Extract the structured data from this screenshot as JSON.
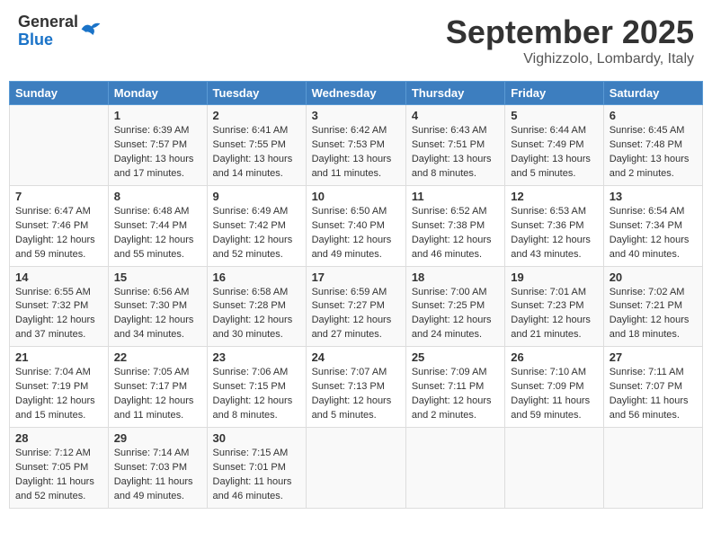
{
  "header": {
    "logo": {
      "general": "General",
      "blue": "Blue"
    },
    "title": "September 2025",
    "location": "Vighizzolo, Lombardy, Italy"
  },
  "calendar": {
    "days_of_week": [
      "Sunday",
      "Monday",
      "Tuesday",
      "Wednesday",
      "Thursday",
      "Friday",
      "Saturday"
    ],
    "weeks": [
      [
        {
          "day": "",
          "sunrise": "",
          "sunset": "",
          "daylight": ""
        },
        {
          "day": "1",
          "sunrise": "Sunrise: 6:39 AM",
          "sunset": "Sunset: 7:57 PM",
          "daylight": "Daylight: 13 hours and 17 minutes."
        },
        {
          "day": "2",
          "sunrise": "Sunrise: 6:41 AM",
          "sunset": "Sunset: 7:55 PM",
          "daylight": "Daylight: 13 hours and 14 minutes."
        },
        {
          "day": "3",
          "sunrise": "Sunrise: 6:42 AM",
          "sunset": "Sunset: 7:53 PM",
          "daylight": "Daylight: 13 hours and 11 minutes."
        },
        {
          "day": "4",
          "sunrise": "Sunrise: 6:43 AM",
          "sunset": "Sunset: 7:51 PM",
          "daylight": "Daylight: 13 hours and 8 minutes."
        },
        {
          "day": "5",
          "sunrise": "Sunrise: 6:44 AM",
          "sunset": "Sunset: 7:49 PM",
          "daylight": "Daylight: 13 hours and 5 minutes."
        },
        {
          "day": "6",
          "sunrise": "Sunrise: 6:45 AM",
          "sunset": "Sunset: 7:48 PM",
          "daylight": "Daylight: 13 hours and 2 minutes."
        }
      ],
      [
        {
          "day": "7",
          "sunrise": "Sunrise: 6:47 AM",
          "sunset": "Sunset: 7:46 PM",
          "daylight": "Daylight: 12 hours and 59 minutes."
        },
        {
          "day": "8",
          "sunrise": "Sunrise: 6:48 AM",
          "sunset": "Sunset: 7:44 PM",
          "daylight": "Daylight: 12 hours and 55 minutes."
        },
        {
          "day": "9",
          "sunrise": "Sunrise: 6:49 AM",
          "sunset": "Sunset: 7:42 PM",
          "daylight": "Daylight: 12 hours and 52 minutes."
        },
        {
          "day": "10",
          "sunrise": "Sunrise: 6:50 AM",
          "sunset": "Sunset: 7:40 PM",
          "daylight": "Daylight: 12 hours and 49 minutes."
        },
        {
          "day": "11",
          "sunrise": "Sunrise: 6:52 AM",
          "sunset": "Sunset: 7:38 PM",
          "daylight": "Daylight: 12 hours and 46 minutes."
        },
        {
          "day": "12",
          "sunrise": "Sunrise: 6:53 AM",
          "sunset": "Sunset: 7:36 PM",
          "daylight": "Daylight: 12 hours and 43 minutes."
        },
        {
          "day": "13",
          "sunrise": "Sunrise: 6:54 AM",
          "sunset": "Sunset: 7:34 PM",
          "daylight": "Daylight: 12 hours and 40 minutes."
        }
      ],
      [
        {
          "day": "14",
          "sunrise": "Sunrise: 6:55 AM",
          "sunset": "Sunset: 7:32 PM",
          "daylight": "Daylight: 12 hours and 37 minutes."
        },
        {
          "day": "15",
          "sunrise": "Sunrise: 6:56 AM",
          "sunset": "Sunset: 7:30 PM",
          "daylight": "Daylight: 12 hours and 34 minutes."
        },
        {
          "day": "16",
          "sunrise": "Sunrise: 6:58 AM",
          "sunset": "Sunset: 7:28 PM",
          "daylight": "Daylight: 12 hours and 30 minutes."
        },
        {
          "day": "17",
          "sunrise": "Sunrise: 6:59 AM",
          "sunset": "Sunset: 7:27 PM",
          "daylight": "Daylight: 12 hours and 27 minutes."
        },
        {
          "day": "18",
          "sunrise": "Sunrise: 7:00 AM",
          "sunset": "Sunset: 7:25 PM",
          "daylight": "Daylight: 12 hours and 24 minutes."
        },
        {
          "day": "19",
          "sunrise": "Sunrise: 7:01 AM",
          "sunset": "Sunset: 7:23 PM",
          "daylight": "Daylight: 12 hours and 21 minutes."
        },
        {
          "day": "20",
          "sunrise": "Sunrise: 7:02 AM",
          "sunset": "Sunset: 7:21 PM",
          "daylight": "Daylight: 12 hours and 18 minutes."
        }
      ],
      [
        {
          "day": "21",
          "sunrise": "Sunrise: 7:04 AM",
          "sunset": "Sunset: 7:19 PM",
          "daylight": "Daylight: 12 hours and 15 minutes."
        },
        {
          "day": "22",
          "sunrise": "Sunrise: 7:05 AM",
          "sunset": "Sunset: 7:17 PM",
          "daylight": "Daylight: 12 hours and 11 minutes."
        },
        {
          "day": "23",
          "sunrise": "Sunrise: 7:06 AM",
          "sunset": "Sunset: 7:15 PM",
          "daylight": "Daylight: 12 hours and 8 minutes."
        },
        {
          "day": "24",
          "sunrise": "Sunrise: 7:07 AM",
          "sunset": "Sunset: 7:13 PM",
          "daylight": "Daylight: 12 hours and 5 minutes."
        },
        {
          "day": "25",
          "sunrise": "Sunrise: 7:09 AM",
          "sunset": "Sunset: 7:11 PM",
          "daylight": "Daylight: 12 hours and 2 minutes."
        },
        {
          "day": "26",
          "sunrise": "Sunrise: 7:10 AM",
          "sunset": "Sunset: 7:09 PM",
          "daylight": "Daylight: 11 hours and 59 minutes."
        },
        {
          "day": "27",
          "sunrise": "Sunrise: 7:11 AM",
          "sunset": "Sunset: 7:07 PM",
          "daylight": "Daylight: 11 hours and 56 minutes."
        }
      ],
      [
        {
          "day": "28",
          "sunrise": "Sunrise: 7:12 AM",
          "sunset": "Sunset: 7:05 PM",
          "daylight": "Daylight: 11 hours and 52 minutes."
        },
        {
          "day": "29",
          "sunrise": "Sunrise: 7:14 AM",
          "sunset": "Sunset: 7:03 PM",
          "daylight": "Daylight: 11 hours and 49 minutes."
        },
        {
          "day": "30",
          "sunrise": "Sunrise: 7:15 AM",
          "sunset": "Sunset: 7:01 PM",
          "daylight": "Daylight: 11 hours and 46 minutes."
        },
        {
          "day": "",
          "sunrise": "",
          "sunset": "",
          "daylight": ""
        },
        {
          "day": "",
          "sunrise": "",
          "sunset": "",
          "daylight": ""
        },
        {
          "day": "",
          "sunrise": "",
          "sunset": "",
          "daylight": ""
        },
        {
          "day": "",
          "sunrise": "",
          "sunset": "",
          "daylight": ""
        }
      ]
    ]
  }
}
